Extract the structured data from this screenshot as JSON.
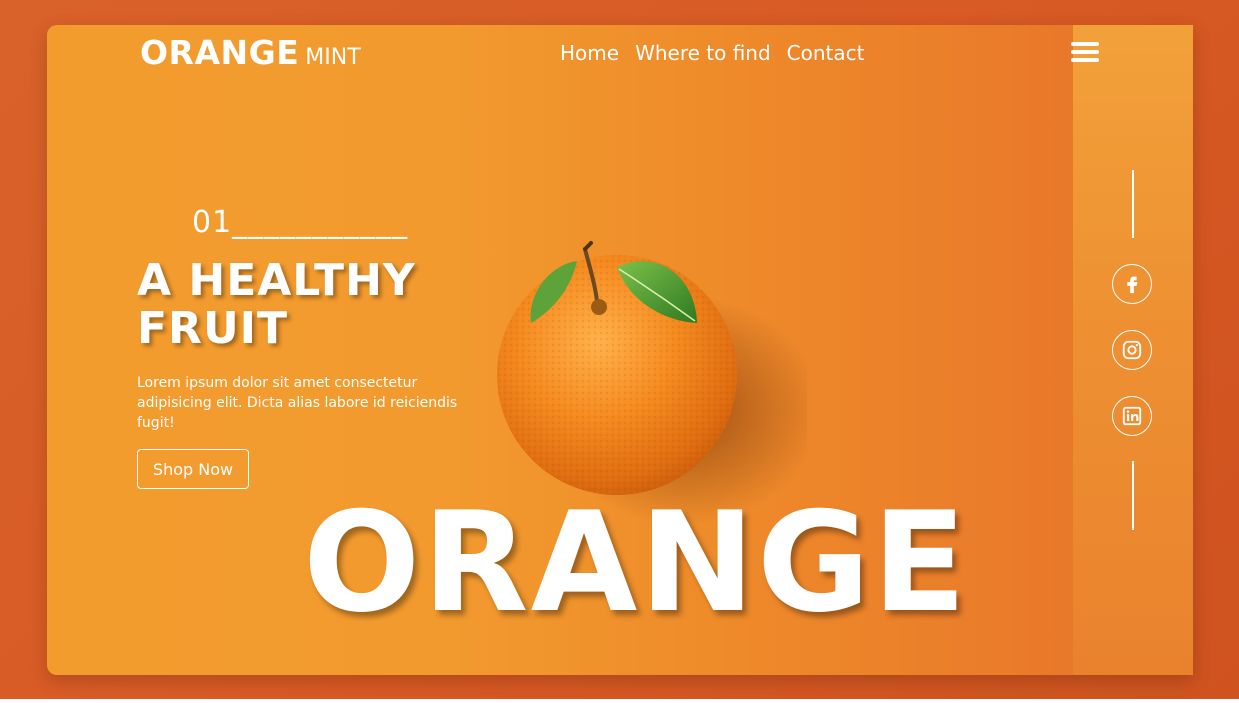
{
  "brand": {
    "main": "ORANGE",
    "sub": "MINT"
  },
  "nav": {
    "items": [
      "Home",
      "Where to find",
      "Contact"
    ]
  },
  "menu": {
    "icon": "hamburger-menu-icon"
  },
  "hero": {
    "counter": "01___________",
    "headline": "A HEALTHY FRUIT",
    "description": "Lorem ipsum dolor sit amet consectetur adipisicing elit. Dicta alias labore id reiciendis fugit!",
    "cta_label": "Shop Now",
    "big_word": "ORANGE"
  },
  "social": {
    "icons": [
      "facebook-icon",
      "instagram-icon",
      "linkedin-icon"
    ]
  },
  "colors": {
    "page_background": "#d85a24",
    "card_left": "#f39c2e",
    "card_right": "#e57428",
    "text": "#ffffff"
  }
}
